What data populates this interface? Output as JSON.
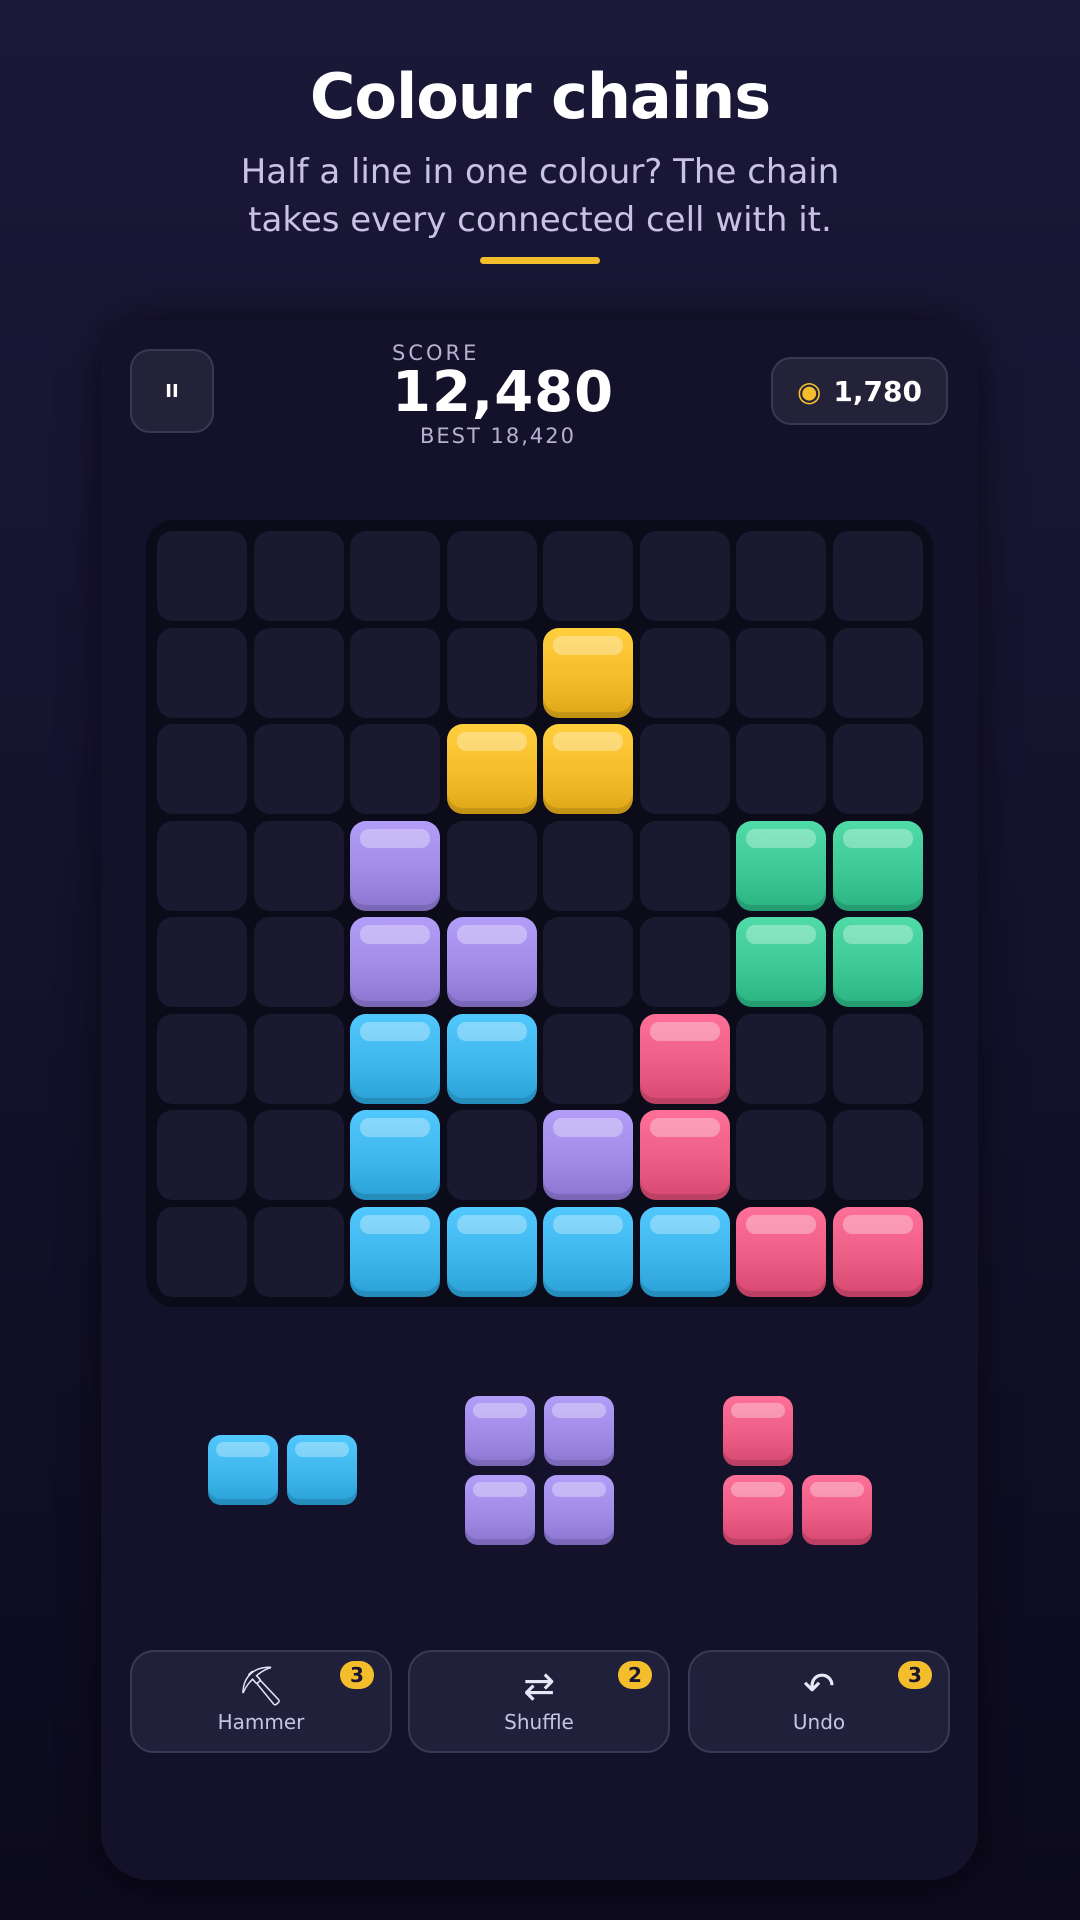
{
  "header": {
    "title": "Colour chains",
    "subtitle": "Half a line in one colour? The chain takes every connected cell with it."
  },
  "colors": {
    "yellow": "#f4bd2b",
    "purple": "#a08ce6",
    "green": "#3ec996",
    "blue": "#3fb6ec",
    "pink": "#ec5e86",
    "accent": "#f4bd2b"
  },
  "hud": {
    "pause_icon": "pause-icon",
    "pause_glyph": "II",
    "score_label": "SCORE",
    "score": "12,480",
    "best_label": "BEST",
    "best": "18,420",
    "coin_icon": "coin-icon",
    "coin_glyph": "◉",
    "coins": "1,780"
  },
  "board": {
    "size": 8,
    "blocks": [
      {
        "row": 1,
        "col": 4,
        "color": "yellow"
      },
      {
        "row": 2,
        "col": 3,
        "color": "yellow"
      },
      {
        "row": 2,
        "col": 4,
        "color": "yellow"
      },
      {
        "row": 3,
        "col": 2,
        "color": "purple"
      },
      {
        "row": 3,
        "col": 6,
        "color": "green"
      },
      {
        "row": 3,
        "col": 7,
        "color": "green"
      },
      {
        "row": 4,
        "col": 2,
        "color": "purple"
      },
      {
        "row": 4,
        "col": 3,
        "color": "purple"
      },
      {
        "row": 4,
        "col": 6,
        "color": "green"
      },
      {
        "row": 4,
        "col": 7,
        "color": "green"
      },
      {
        "row": 5,
        "col": 2,
        "color": "blue"
      },
      {
        "row": 5,
        "col": 3,
        "color": "blue"
      },
      {
        "row": 5,
        "col": 5,
        "color": "pink"
      },
      {
        "row": 6,
        "col": 2,
        "color": "blue"
      },
      {
        "row": 6,
        "col": 4,
        "color": "purple"
      },
      {
        "row": 6,
        "col": 5,
        "color": "pink"
      },
      {
        "row": 7,
        "col": 2,
        "color": "blue"
      },
      {
        "row": 7,
        "col": 3,
        "color": "blue"
      },
      {
        "row": 7,
        "col": 4,
        "color": "blue"
      },
      {
        "row": 7,
        "col": 5,
        "color": "blue"
      },
      {
        "row": 7,
        "col": 6,
        "color": "pink"
      },
      {
        "row": 7,
        "col": 7,
        "color": "pink"
      }
    ]
  },
  "tray": [
    {
      "color": "blue",
      "cells": [
        [
          0,
          0
        ],
        [
          0,
          1
        ]
      ]
    },
    {
      "color": "purple",
      "cells": [
        [
          0,
          0
        ],
        [
          0,
          1
        ],
        [
          1,
          0
        ],
        [
          1,
          1
        ]
      ]
    },
    {
      "color": "pink",
      "cells": [
        [
          0,
          0
        ],
        [
          1,
          0
        ],
        [
          1,
          1
        ]
      ]
    }
  ],
  "powerups": [
    {
      "icon": "hammer-icon",
      "glyph": "⛏",
      "label": "Hammer",
      "count": "3"
    },
    {
      "icon": "shuffle-icon",
      "glyph": "⇄",
      "label": "Shuffle",
      "count": "2"
    },
    {
      "icon": "undo-icon",
      "glyph": "↶",
      "label": "Undo",
      "count": "3"
    }
  ]
}
